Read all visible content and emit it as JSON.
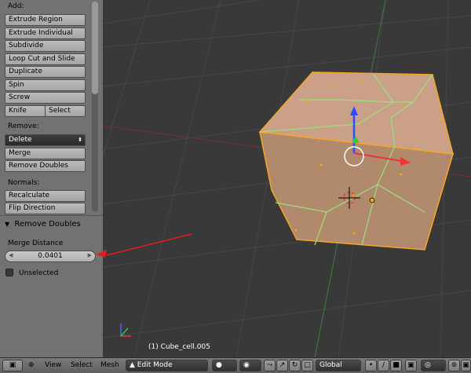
{
  "toolshelf": {
    "add_label": "Add:",
    "add_buttons": [
      "Extrude Region",
      "Extrude Individual",
      "Subdivide",
      "Loop Cut and Slide",
      "Duplicate",
      "Spin",
      "Screw"
    ],
    "knife_label": "Knife",
    "select_label": "Select",
    "remove_label": "Remove:",
    "remove_buttons": [
      "Delete",
      "Merge",
      "Remove Doubles"
    ],
    "normals_label": "Normals:",
    "normals_buttons": [
      "Recalculate",
      "Flip Direction"
    ]
  },
  "operator_panel": {
    "title": "Remove Doubles",
    "merge_distance_label": "Merge Distance",
    "merge_distance_value": "0.0401",
    "unselected_label": "Unselected"
  },
  "viewport": {
    "object_label": "(1) Cube_cell.005"
  },
  "header": {
    "menu_view": "View",
    "menu_select": "Select",
    "menu_mesh": "Mesh",
    "mode": "Edit Mode",
    "orientation": "Global"
  },
  "colors": {
    "panel": "#727272",
    "viewport": "#393939",
    "cube_top": "#caa088",
    "cube_front": "#b18a6e",
    "selection_edge": "#f5a623",
    "cell_edge": "#9be27a",
    "annotation_arrow": "#e02020"
  }
}
